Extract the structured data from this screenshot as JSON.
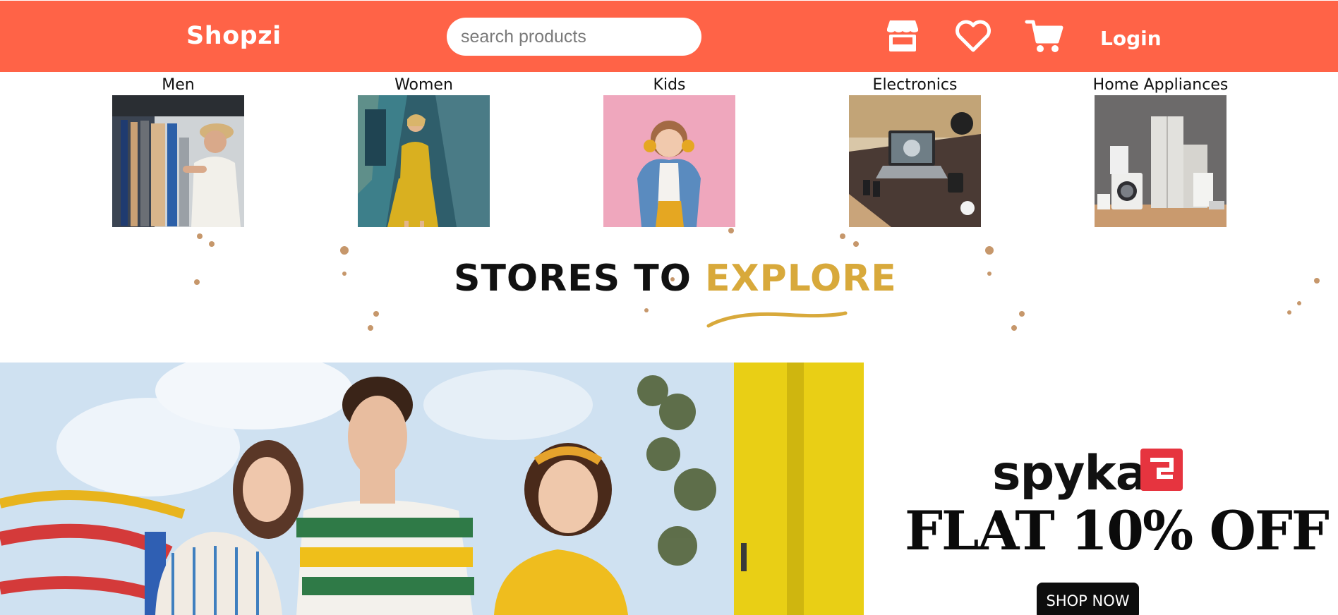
{
  "header": {
    "brand": "Shopzi",
    "search_placeholder": "search products",
    "icons": [
      "store-icon",
      "heart-icon",
      "cart-icon"
    ],
    "login_label": "Login",
    "background_color": "#ff6347"
  },
  "categories": [
    {
      "label": "Men",
      "image": "men-category-image"
    },
    {
      "label": "Women",
      "image": "women-category-image"
    },
    {
      "label": "Kids",
      "image": "kids-category-image"
    },
    {
      "label": "Electronics",
      "image": "electronics-category-image"
    },
    {
      "label": "Home Appliances",
      "image": "home-appliances-category-image"
    }
  ],
  "explore": {
    "title_part1": "STORES TO",
    "title_part2": "EXPLORE",
    "accent_color": "#d8a93b"
  },
  "banner": {
    "brand": "spykar",
    "offer": "FLAT 10% OFF",
    "cta_label": "SHOP NOW",
    "brand_color": "#e6343f"
  }
}
